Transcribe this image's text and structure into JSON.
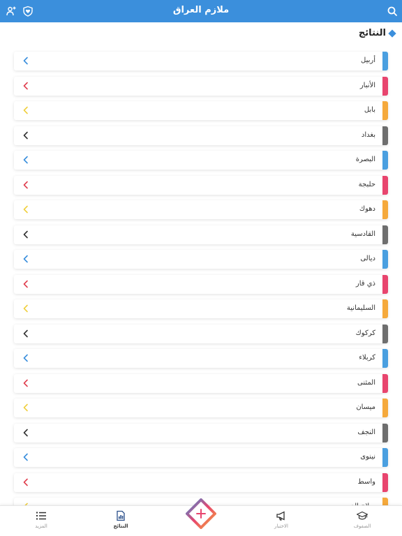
{
  "header": {
    "title": "ملازم العراق",
    "icons": [
      "search-icon",
      "heart-shield-icon",
      "add-user-icon"
    ]
  },
  "section": {
    "title": "النتائج"
  },
  "provinces": [
    {
      "name": "أربيل",
      "color": "#4a9fe0"
    },
    {
      "name": "الأنبار",
      "color": "#e8456e"
    },
    {
      "name": "بابل",
      "color": "#f5a93c"
    },
    {
      "name": "بغداد",
      "color": "#6e6e6e"
    },
    {
      "name": "البصرة",
      "color": "#4a9fe0"
    },
    {
      "name": "حلبجة",
      "color": "#e8456e"
    },
    {
      "name": "دهوك",
      "color": "#f5a93c"
    },
    {
      "name": "القادسية",
      "color": "#6e6e6e"
    },
    {
      "name": "ديالى",
      "color": "#4a9fe0"
    },
    {
      "name": "ذي قار",
      "color": "#e8456e"
    },
    {
      "name": "السليمانية",
      "color": "#f5a93c"
    },
    {
      "name": "كركوك",
      "color": "#6e6e6e"
    },
    {
      "name": "كربلاء",
      "color": "#4a9fe0"
    },
    {
      "name": "المثنى",
      "color": "#e8456e"
    },
    {
      "name": "ميسان",
      "color": "#f5a93c"
    },
    {
      "name": "النجف",
      "color": "#6e6e6e"
    },
    {
      "name": "نينوى",
      "color": "#4a9fe0"
    },
    {
      "name": "واسط",
      "color": "#e8456e"
    },
    {
      "name": "صلاح الدين",
      "color": "#f5a93c"
    }
  ],
  "chevron_colors": {
    "#4a9fe0": "#3b8fdc",
    "#e8456e": "#e04050",
    "#f5a93c": "#f0d040",
    "#6e6e6e": "#333333"
  },
  "nav": {
    "more": "المزيد",
    "results": "النتائج",
    "exams": "الاختبار",
    "classes": "الصفوف"
  }
}
